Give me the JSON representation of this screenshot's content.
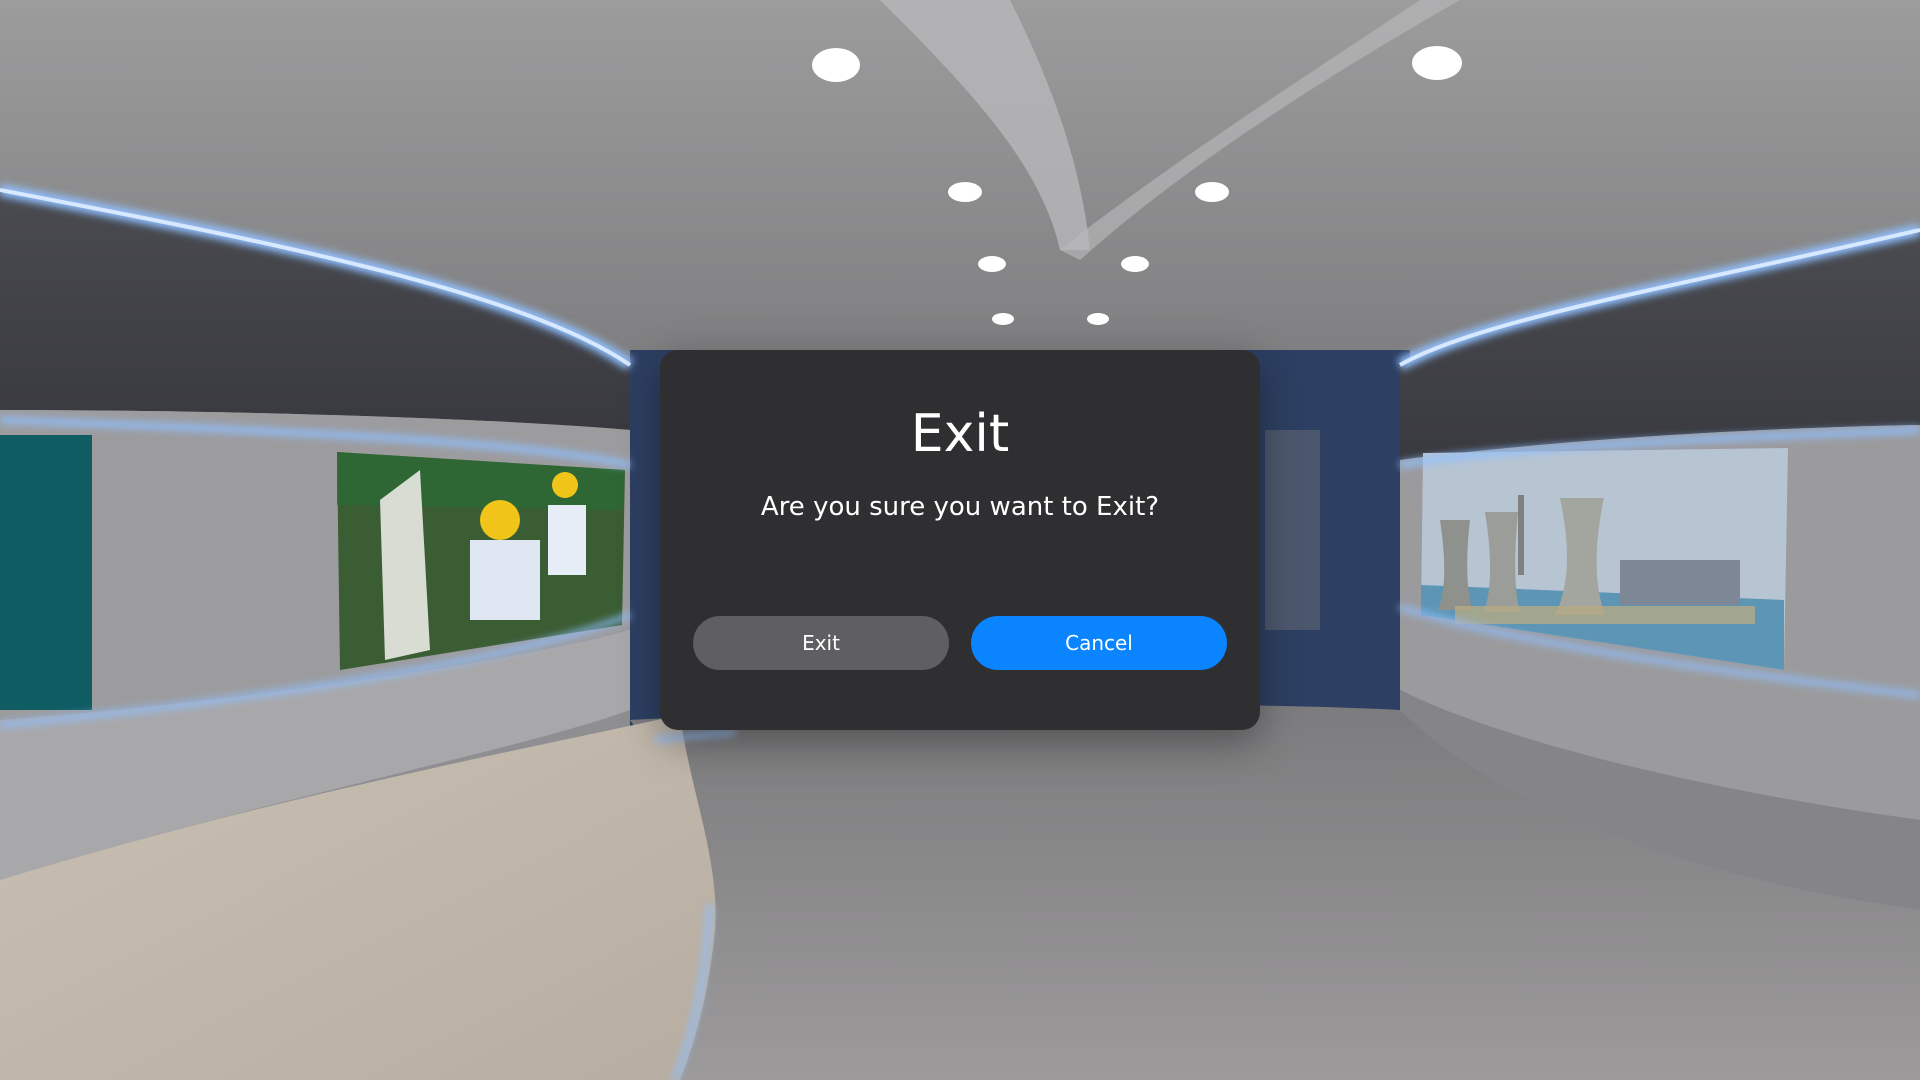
{
  "dialog": {
    "title": "Exit",
    "message": "Are you sure you want to Exit?",
    "exit_label": "Exit",
    "cancel_label": "Cancel"
  },
  "colors": {
    "dialog_background": "#2f2f31",
    "exit_button": "#5f5f61",
    "cancel_button": "#0a84ff",
    "neon_accent": "#7fb4ff"
  },
  "scene": {
    "description_icons": [
      "virtual-gallery-scene"
    ]
  }
}
